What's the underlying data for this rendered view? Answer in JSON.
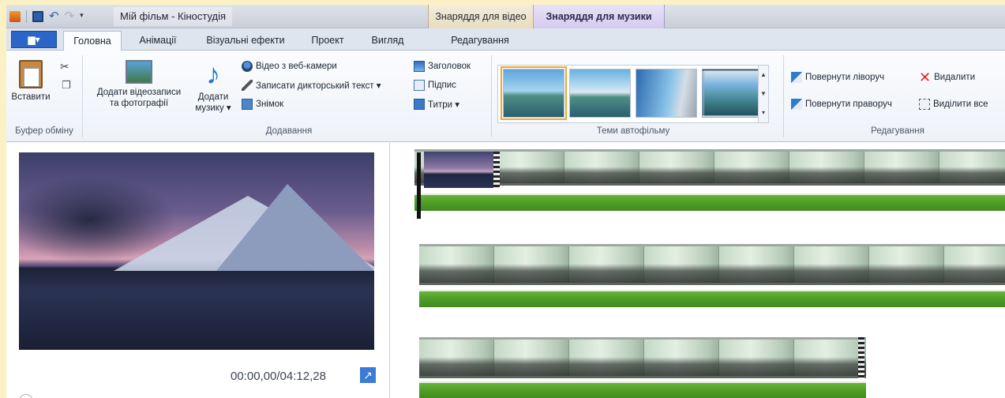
{
  "window": {
    "title": "Мій фільм - Кіностудія",
    "context_tabs": {
      "video_tools": "Знаряддя для відео",
      "music_tools": "Знаряддя для музики"
    }
  },
  "tabs": {
    "file": "▆▾",
    "items": [
      "Головна",
      "Анімації",
      "Візуальні ефекти",
      "Проект",
      "Вигляд",
      "Редагування"
    ],
    "active": "Головна"
  },
  "ribbon": {
    "clipboard": {
      "paste": "Вставити",
      "group": "Буфер обміну"
    },
    "add": {
      "add_video_l1": "Додати відеозаписи",
      "add_video_l2": "та фотографії",
      "add_music_l1": "Додати",
      "add_music_l2": "музику ▾",
      "webcam": "Відео з веб-камери",
      "narration": "Записати дикторський текст ▾",
      "snapshot": "Знімок",
      "title": "Заголовок",
      "caption": "Підпис",
      "credits": "Титри ▾",
      "group": "Додавання"
    },
    "themes": {
      "group": "Теми автофільму",
      "selected_index": 0
    },
    "editing": {
      "rotate_left": "Повернути ліворуч",
      "rotate_right": "Повернути праворуч",
      "delete": "Видалити",
      "select_all": "Виділити все",
      "group": "Редагування"
    }
  },
  "preview": {
    "timecode": "00:00,00/04:12,28"
  },
  "icons": [
    "app-icon",
    "save-icon",
    "undo-icon",
    "redo-icon",
    "cut-icon",
    "copy-icon",
    "paste-icon",
    "music-note-icon",
    "webcam-icon",
    "microphone-icon",
    "snapshot-icon",
    "title-icon",
    "caption-icon",
    "credits-icon",
    "rotate-left-icon",
    "rotate-right-icon",
    "delete-icon",
    "select-all-icon",
    "fullscreen-icon"
  ],
  "colors": {
    "file_button": "#2a65c7",
    "audio_track": "#52a12a",
    "selected_theme": "#f0a830",
    "background": "#fbf1c4"
  }
}
